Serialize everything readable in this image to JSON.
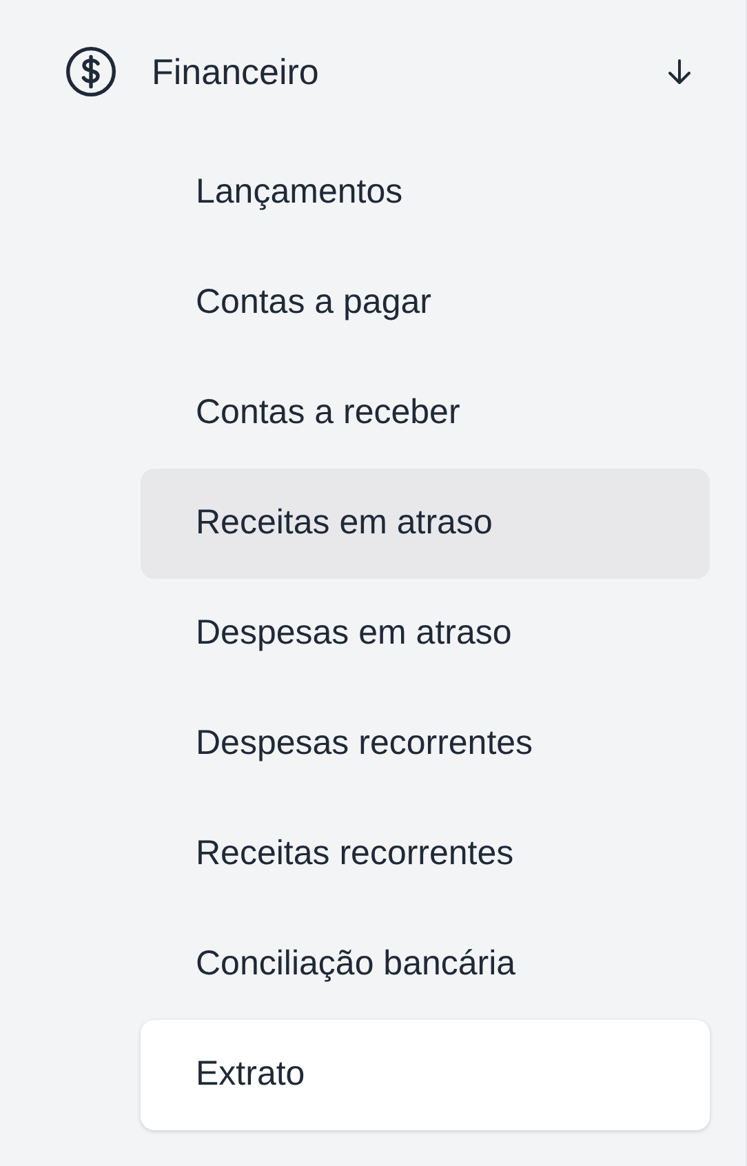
{
  "menu": {
    "label": "Financeiro",
    "expanded": true,
    "items": [
      {
        "label": "Lançamentos",
        "selected": false,
        "hovered": false
      },
      {
        "label": "Contas a pagar",
        "selected": false,
        "hovered": false
      },
      {
        "label": "Contas a receber",
        "selected": false,
        "hovered": false
      },
      {
        "label": "Receitas em atraso",
        "selected": false,
        "hovered": true
      },
      {
        "label": "Despesas em atraso",
        "selected": false,
        "hovered": false
      },
      {
        "label": "Despesas recorrentes",
        "selected": false,
        "hovered": false
      },
      {
        "label": "Receitas recorrentes",
        "selected": false,
        "hovered": false
      },
      {
        "label": "Conciliação bancária",
        "selected": false,
        "hovered": false
      },
      {
        "label": "Extrato",
        "selected": true,
        "hovered": false
      }
    ]
  }
}
